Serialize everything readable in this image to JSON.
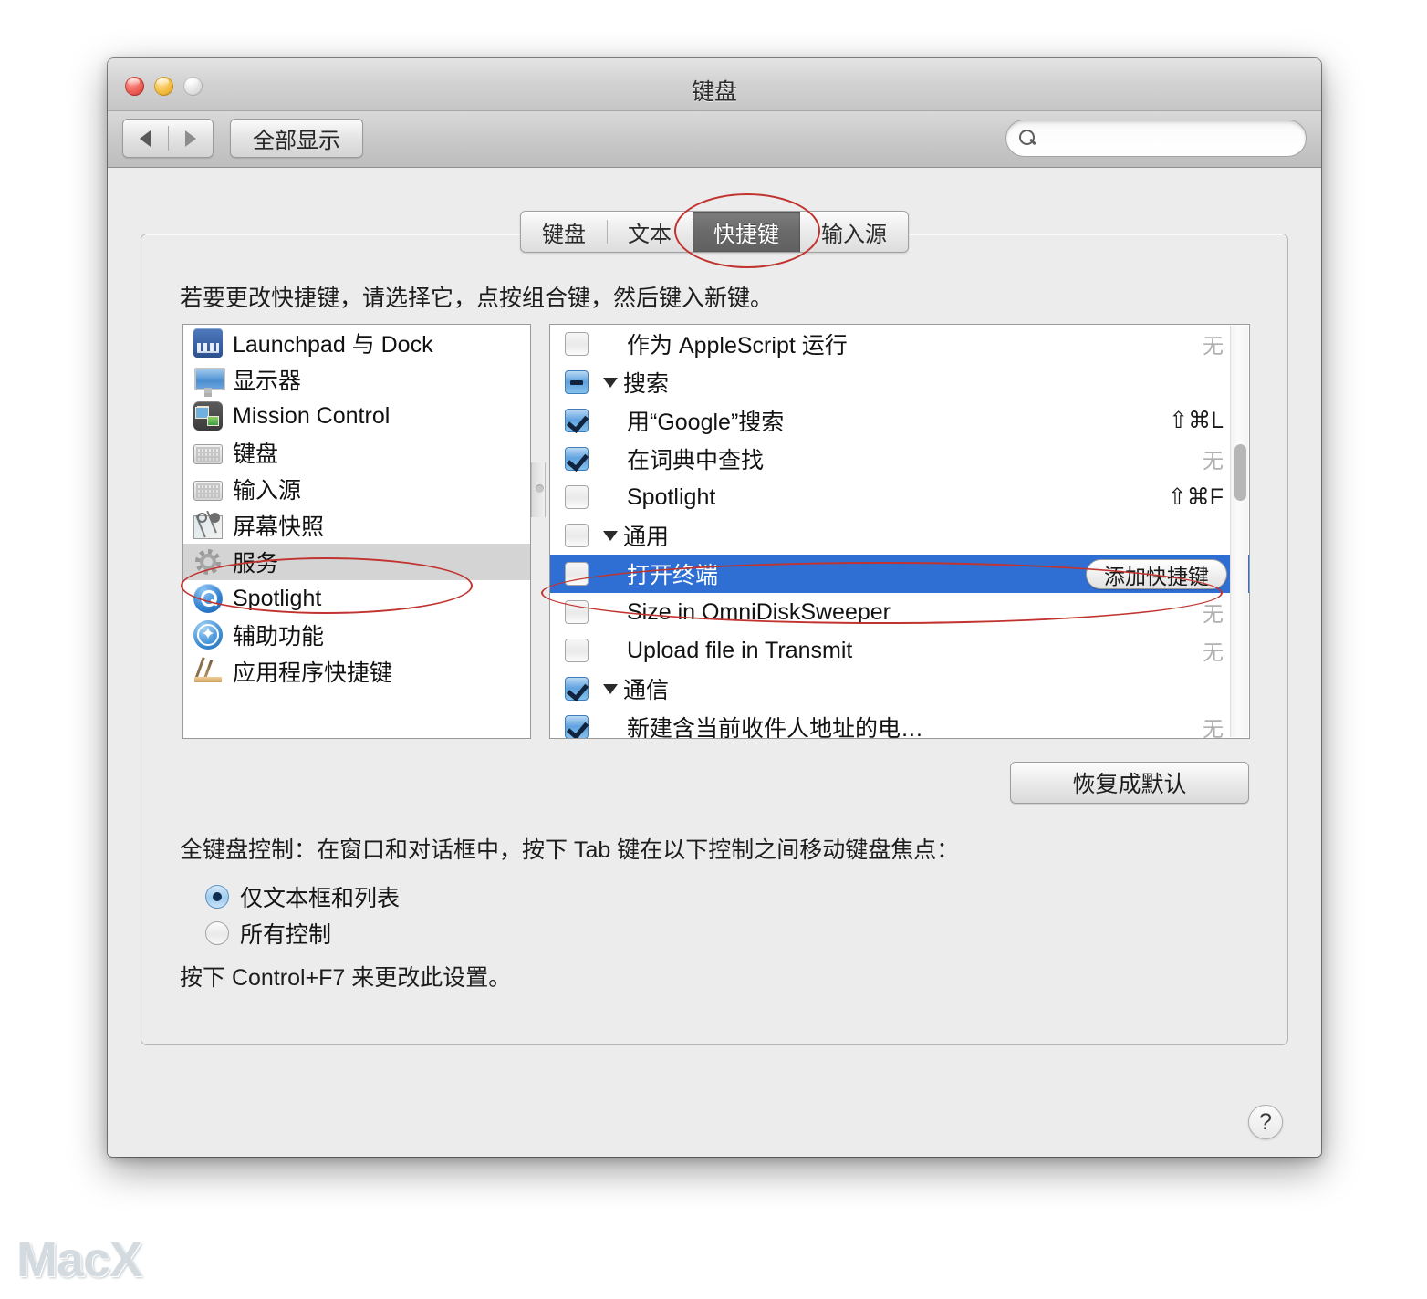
{
  "window": {
    "title": "键盘",
    "traffic_lights": [
      "close",
      "minimize",
      "zoom"
    ]
  },
  "toolbar": {
    "back_label": "◀",
    "forward_label": "▶",
    "show_all_label": "全部显示",
    "search_value": "",
    "search_placeholder": ""
  },
  "tabs": [
    {
      "label": "键盘",
      "active": false
    },
    {
      "label": "文本",
      "active": false
    },
    {
      "label": "快捷键",
      "active": true
    },
    {
      "label": "输入源",
      "active": false
    }
  ],
  "instruction": "若要更改快捷键，请选择它，点按组合键，然后键入新键。",
  "sidebar": {
    "items": [
      {
        "label": "Launchpad 与 Dock",
        "icon": "launchpad-icon",
        "icon_class": "ic-launchpad",
        "selected": false
      },
      {
        "label": "显示器",
        "icon": "display-icon",
        "icon_class": "ic-display",
        "selected": false
      },
      {
        "label": "Mission Control",
        "icon": "mission-control-icon",
        "icon_class": "ic-mission",
        "selected": false
      },
      {
        "label": "键盘",
        "icon": "keyboard-icon",
        "icon_class": "ic-keyboard",
        "selected": false
      },
      {
        "label": "输入源",
        "icon": "input-source-icon",
        "icon_class": "ic-inputsrc",
        "selected": false
      },
      {
        "label": "屏幕快照",
        "icon": "screenshot-icon",
        "icon_class": "ic-screenshot",
        "selected": false
      },
      {
        "label": "服务",
        "icon": "gear-icon",
        "icon_class": "ic-services",
        "selected": true
      },
      {
        "label": "Spotlight",
        "icon": "spotlight-icon",
        "icon_class": "ic-spotlight",
        "selected": false
      },
      {
        "label": "辅助功能",
        "icon": "accessibility-icon",
        "icon_class": "ic-accessibility",
        "selected": false
      },
      {
        "label": "应用程序快捷键",
        "icon": "app-shortcuts-icon",
        "icon_class": "ic-appshortcut",
        "selected": false
      }
    ]
  },
  "shortcut_list": {
    "rows": [
      {
        "label": "作为 AppleScript 运行",
        "checkbox": "off",
        "indent": "child",
        "group": false,
        "key": "无",
        "key_none": true,
        "selected": false,
        "button": null
      },
      {
        "label": "搜索",
        "checkbox": "mixed",
        "indent": "group",
        "group": true,
        "key": "",
        "key_none": false,
        "selected": false,
        "button": null
      },
      {
        "label": "用“Google”搜索",
        "checkbox": "on",
        "indent": "child",
        "group": false,
        "key": "⇧⌘L",
        "key_none": false,
        "selected": false,
        "button": null
      },
      {
        "label": "在词典中查找",
        "checkbox": "on",
        "indent": "child",
        "group": false,
        "key": "无",
        "key_none": true,
        "selected": false,
        "button": null
      },
      {
        "label": "Spotlight",
        "checkbox": "off",
        "indent": "child",
        "group": false,
        "key": "⇧⌘F",
        "key_none": false,
        "selected": false,
        "button": null
      },
      {
        "label": "通用",
        "checkbox": "off",
        "indent": "group",
        "group": true,
        "key": "",
        "key_none": false,
        "selected": false,
        "button": null
      },
      {
        "label": "打开终端",
        "checkbox": "off",
        "indent": "child",
        "group": false,
        "key": "",
        "key_none": false,
        "selected": true,
        "button": "添加快捷键"
      },
      {
        "label": "Size in OmniDiskSweeper",
        "checkbox": "off",
        "indent": "child",
        "group": false,
        "key": "无",
        "key_none": true,
        "selected": false,
        "button": null
      },
      {
        "label": "Upload file in Transmit",
        "checkbox": "off",
        "indent": "child",
        "group": false,
        "key": "无",
        "key_none": true,
        "selected": false,
        "button": null
      },
      {
        "label": "通信",
        "checkbox": "on",
        "indent": "group",
        "group": true,
        "key": "",
        "key_none": false,
        "selected": false,
        "button": null
      },
      {
        "label": "新建含当前收件人地址的电…",
        "checkbox": "on",
        "indent": "child",
        "group": false,
        "key": "无",
        "key_none": true,
        "selected": false,
        "button": null
      }
    ]
  },
  "restore_defaults_label": "恢复成默认",
  "full_keyboard_control": {
    "label": "全键盘控制：在窗口和对话框中，按下 Tab 键在以下控制之间移动键盘焦点：",
    "options": [
      {
        "label": "仅文本框和列表",
        "selected": true
      },
      {
        "label": "所有控制",
        "selected": false
      }
    ],
    "note": "按下 Control+F7 来更改此设置。"
  },
  "help_label": "?",
  "watermark": "MacX",
  "colors": {
    "selection_blue": "#2f6fd4",
    "sidebar_selection_gray": "#d4d4d4",
    "annotation_red": "#c1332f",
    "active_tab_gray": "#6a6a6a"
  }
}
